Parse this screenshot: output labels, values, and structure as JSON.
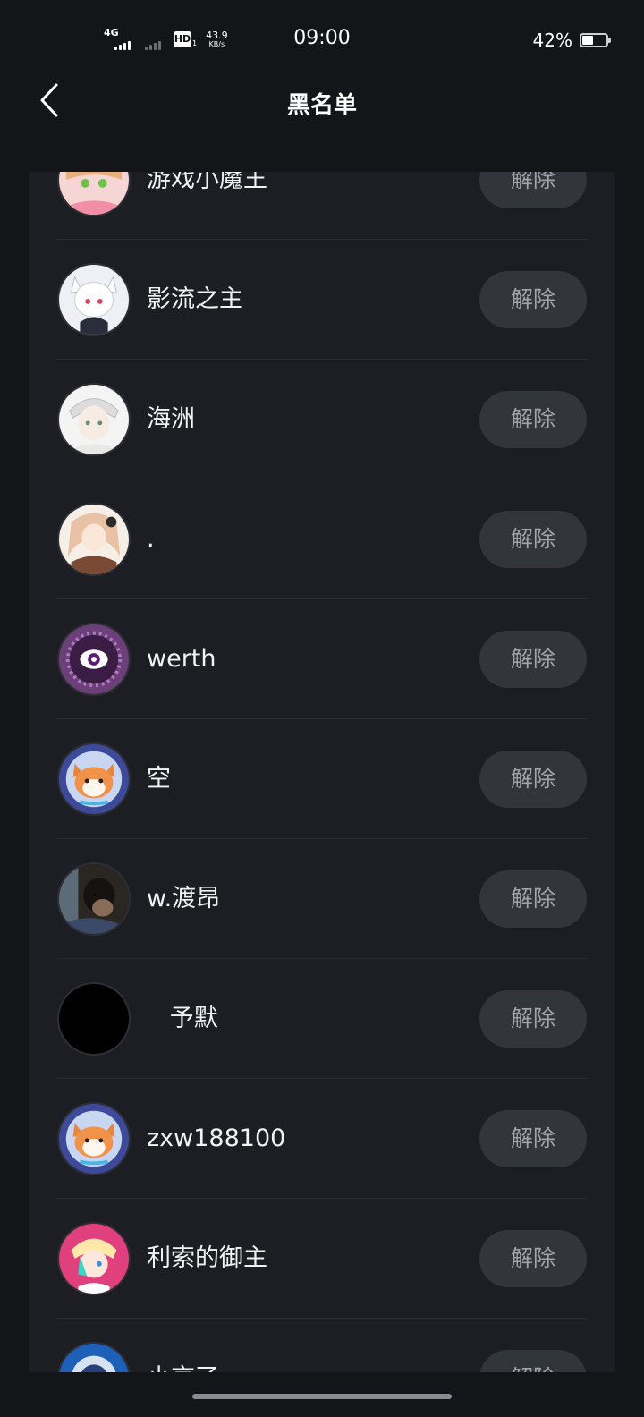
{
  "status_bar": {
    "network": "4G",
    "hd": "HD",
    "hd_sub": "1",
    "speed_value": "43.9",
    "speed_unit": "KB/s",
    "time": "09:00",
    "battery_percent": "42%",
    "battery_level": 0.42
  },
  "header": {
    "title": "黑名单",
    "back_icon": "chevron-left-icon"
  },
  "blacklist": [
    {
      "name": "游戏小魔王",
      "action": "解除",
      "avatar": "anime-girl-pink-avatar"
    },
    {
      "name": "影流之主",
      "action": "解除",
      "avatar": "white-cat-boy-avatar"
    },
    {
      "name": "海洲",
      "action": "解除",
      "avatar": "white-hair-boy-avatar"
    },
    {
      "name": ".",
      "action": "解除",
      "avatar": "anime-girl-brown-avatar"
    },
    {
      "name": "werth",
      "action": "解除",
      "avatar": "purple-eye-avatar"
    },
    {
      "name": "空",
      "action": "解除",
      "avatar": "shiba-dog-avatar"
    },
    {
      "name": "w.渡昂",
      "action": "解除",
      "avatar": "photo-person-avatar"
    },
    {
      "name": "   予默",
      "action": "解除",
      "avatar": "black-avatar"
    },
    {
      "name": "zxw188100",
      "action": "解除",
      "avatar": "shiba-dog-avatar"
    },
    {
      "name": "利索的御主",
      "action": "解除",
      "avatar": "anime-pink-green-avatar"
    },
    {
      "name": "小京了",
      "action": "解除",
      "avatar": "blue-circle-avatar"
    }
  ],
  "colors": {
    "background": "#141519",
    "panel": "#1d1e23",
    "button": "#33353c",
    "button_text": "#a3a4aa"
  }
}
